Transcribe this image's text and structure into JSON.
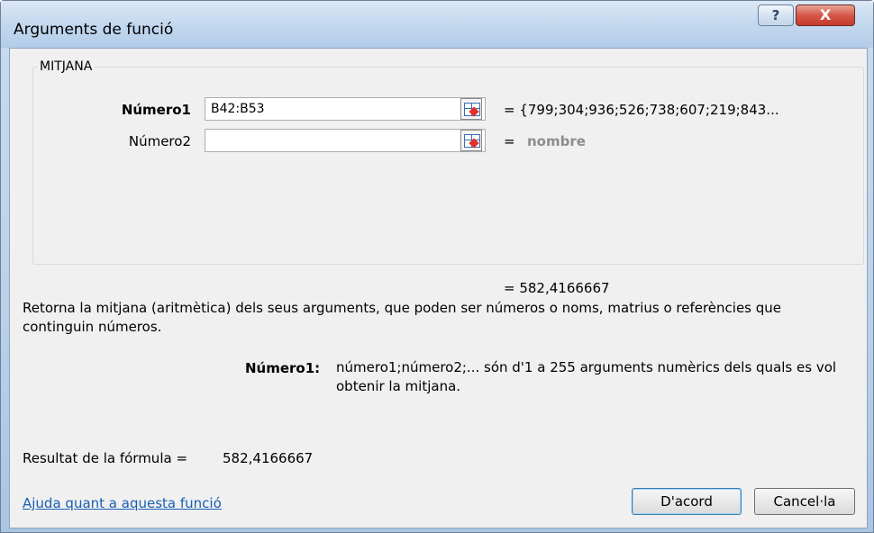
{
  "window": {
    "title": "Arguments de funció",
    "help_button": "?",
    "close_button": "X"
  },
  "group": {
    "legend": "MITJANA"
  },
  "args": [
    {
      "label": "Número1",
      "value": "B42:B53",
      "result": "=  {799;304;936;526;738;607;219;843..."
    },
    {
      "label": "Número2",
      "value": "",
      "result_eq": "=",
      "result": "nombre"
    }
  ],
  "function_result": "=  582,4166667",
  "description": "Retorna la mitjana (aritmètica) dels seus arguments, que poden ser números o noms, matrius o referències que continguin números.",
  "arg_help": {
    "label": "Número1:",
    "text": "número1;número2;... són d'1 a 255 arguments numèrics dels quals es vol obtenir la mitjana."
  },
  "formula_result": {
    "label": "Resultat de la fórmula =",
    "value": "582,4166667"
  },
  "help_link": "Ajuda quant a aquesta funció",
  "buttons": {
    "ok": "D'acord",
    "cancel": "Cancel·la"
  }
}
